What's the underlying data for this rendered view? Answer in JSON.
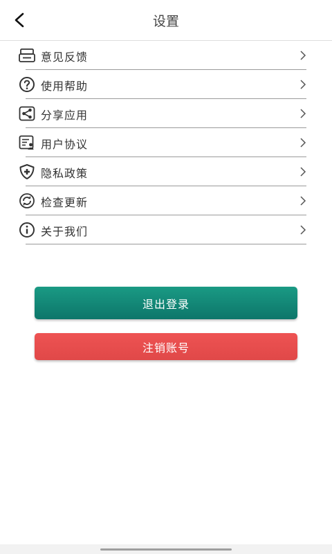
{
  "header": {
    "title": "设置",
    "back_icon": "chevron-left-icon"
  },
  "menu": {
    "items": [
      {
        "label": "意见反馈",
        "icon": "feedback-icon"
      },
      {
        "label": "使用帮助",
        "icon": "help-icon"
      },
      {
        "label": "分享应用",
        "icon": "share-icon"
      },
      {
        "label": "用户协议",
        "icon": "user-agreement-icon"
      },
      {
        "label": "隐私政策",
        "icon": "privacy-shield-icon"
      },
      {
        "label": "检查更新",
        "icon": "refresh-icon"
      },
      {
        "label": "关于我们",
        "icon": "info-icon"
      }
    ]
  },
  "buttons": {
    "logout_label": "退出登录",
    "delete_account_label": "注销账号"
  },
  "colors": {
    "logout_button": "#0f8575",
    "delete_button": "#e84d4d",
    "text": "#333333"
  }
}
